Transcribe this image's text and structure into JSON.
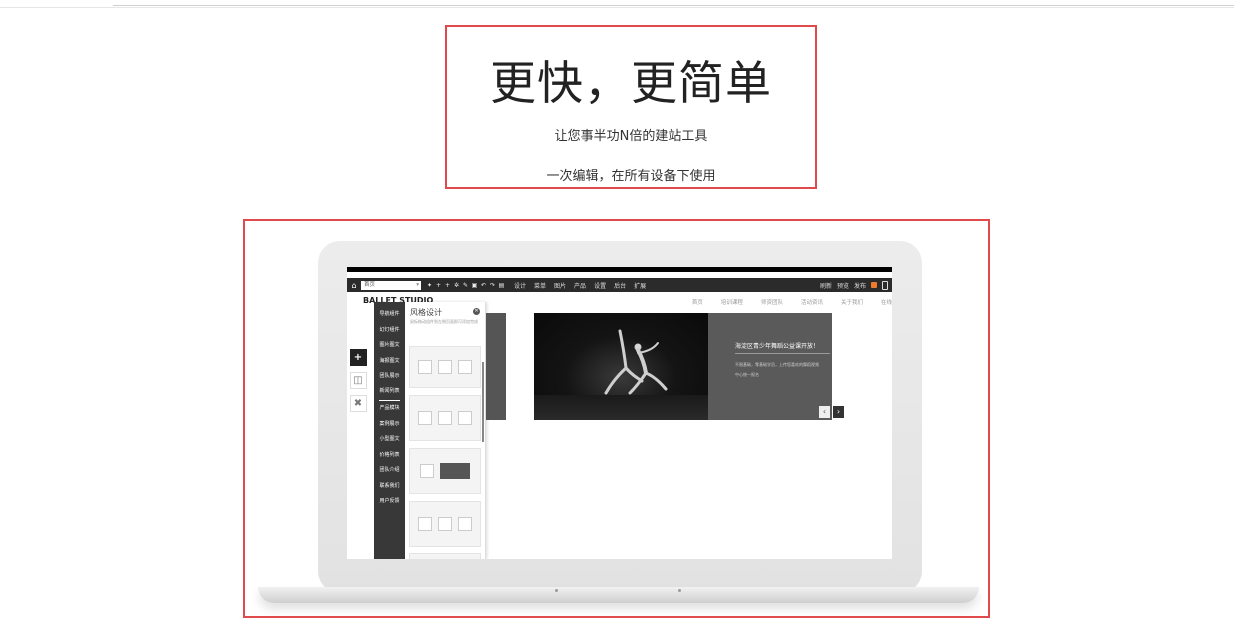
{
  "hero": {
    "headline": "更快，更简单",
    "subtitle_1": "让您事半功N倍的建站工具",
    "subtitle_2": "一次编辑，在所有设备下使用"
  },
  "editor": {
    "page_select": "首页",
    "menus": [
      "设计",
      "菜单",
      "图片",
      "产品",
      "设置",
      "后台",
      "扩展"
    ],
    "right_actions": [
      "刷新",
      "预览",
      "发布"
    ],
    "accent_color": "#f07b2a"
  },
  "site": {
    "brand": "BALLET STUDIO",
    "nav": [
      "首页",
      "培训课程",
      "师资团队",
      "活动资讯",
      "关于我们",
      "在线"
    ]
  },
  "left_tools": [
    "plus-icon",
    "layout-icon",
    "close-icon"
  ],
  "categories": [
    "导航组件",
    "幻灯组件",
    "图片图文",
    "海报图文",
    "团队展示",
    "新闻列表",
    "产品模块",
    "案例展示",
    "小型图文",
    "价格列表",
    "团队介绍",
    "联系我们",
    "用户反馈"
  ],
  "template_panel": {
    "title": "风格设计",
    "description": "鼠标拖动组件到左侧页面即可添加完成"
  },
  "slide": {
    "title": "海淀区青少年舞蹈公益课开放！",
    "line_1": "不限基础，零基础学员，上传您喜欢的舞蹈视频",
    "line_2": "中心统一报名"
  }
}
